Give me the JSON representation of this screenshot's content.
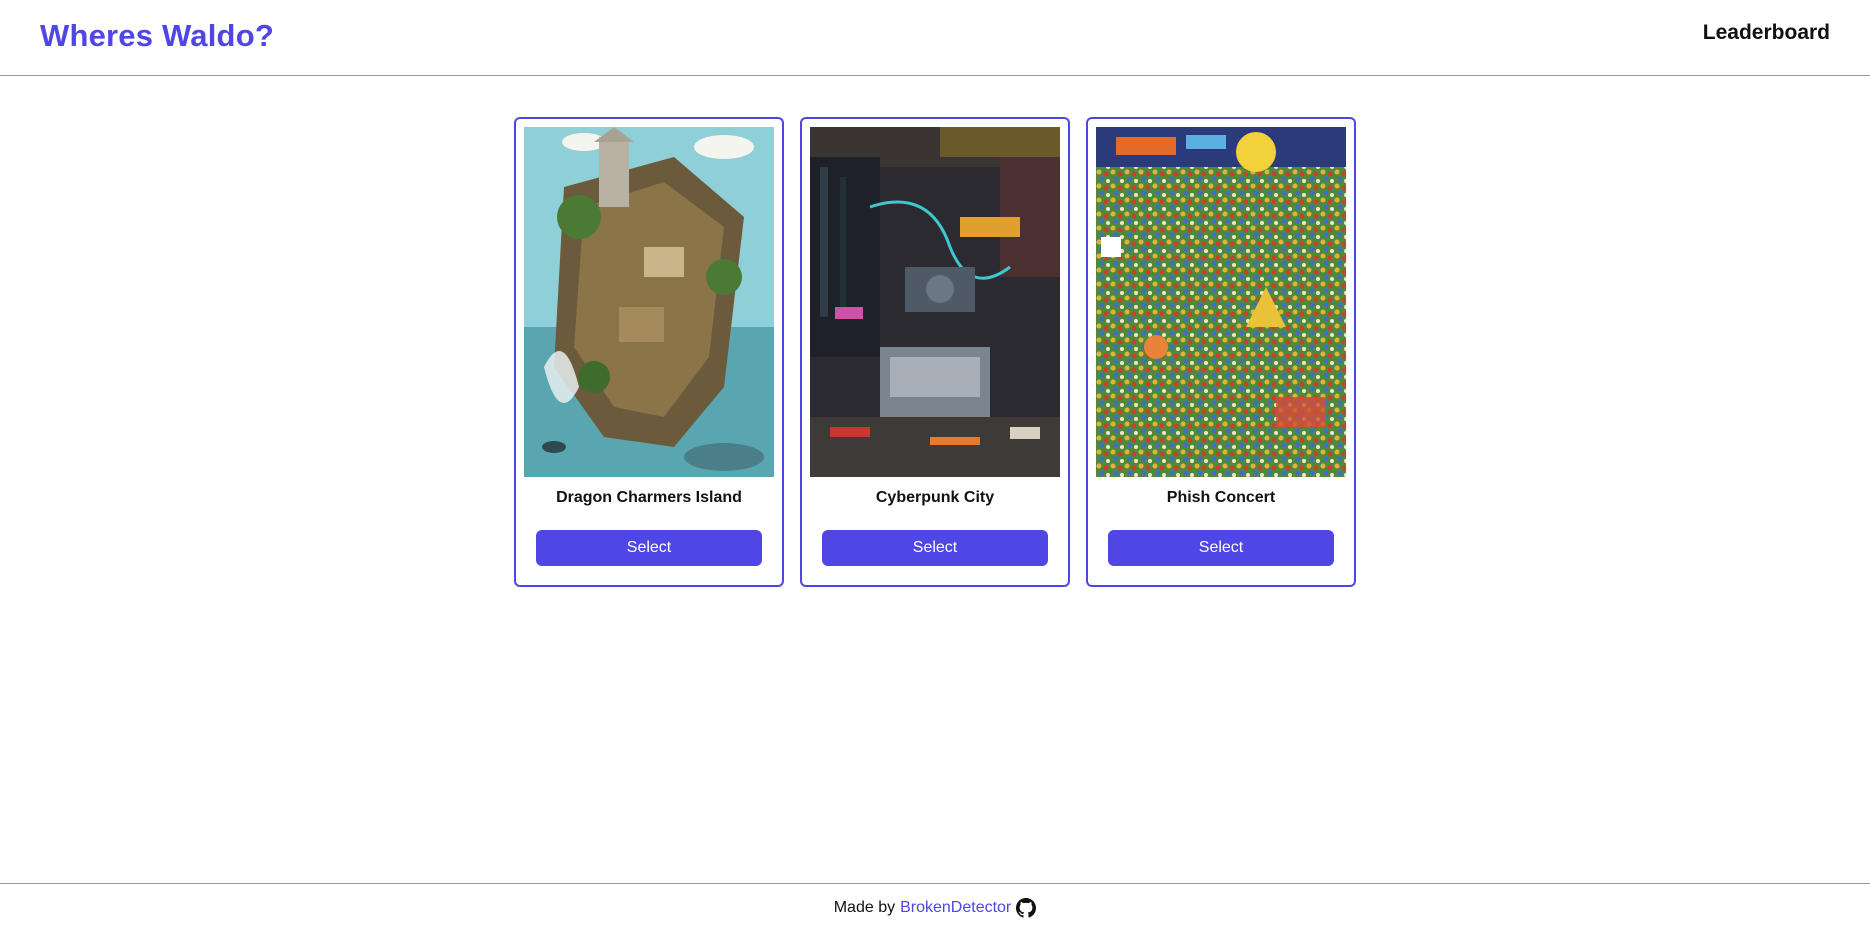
{
  "header": {
    "brand": "Wheres Waldo?",
    "leaderboard_label": "Leaderboard"
  },
  "cards": [
    {
      "title": "Dragon Charmers Island",
      "button": "Select",
      "image_icon": "dragon-charmers-island-image"
    },
    {
      "title": "Cyberpunk City",
      "button": "Select",
      "image_icon": "cyberpunk-city-image"
    },
    {
      "title": "Phish Concert",
      "button": "Select",
      "image_icon": "phish-concert-image"
    }
  ],
  "footer": {
    "made_by": "Made by",
    "author": "BrokenDetector",
    "icon": "github-icon"
  },
  "colors": {
    "accent": "#4f46e5",
    "text": "#111111",
    "divider": "#9a9a9a"
  }
}
